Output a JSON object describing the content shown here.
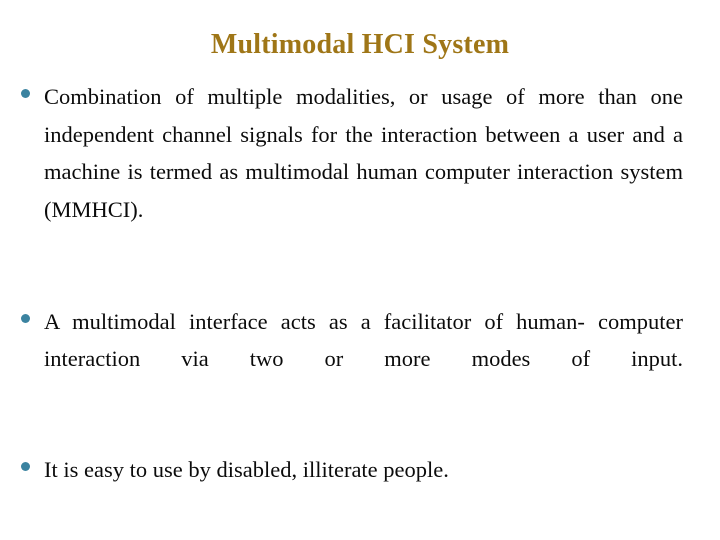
{
  "slide": {
    "title": "Multimodal HCI System",
    "title_color": "#9f7617",
    "background_color": "#ffffff",
    "body_text_color": "#0b0b0b",
    "bullet_marker_color": "#3b83a0",
    "bullets": [
      {
        "id": "bullet-combination-of-modalities",
        "marker": "disc-bullet-icon",
        "text": "Combination of multiple modalities, or usage of more than one independent channel signals for the interaction between a user and a machine is termed as multimodal human computer interaction system (MMHCI).",
        "lines": [
          "Combination of multiple modalities, or usage of",
          "more than one independent channel signals for the",
          "interaction between a user and a machine is termed as",
          "multimodal human computer interaction system",
          "(MMHCI)."
        ]
      },
      {
        "id": "bullet-multimodal-interface-facilitator",
        "marker": "disc-bullet-icon",
        "text": "A multimodal interface acts as a facilitator of human- computer interaction via two or more modes of input.",
        "lines": [
          "A multimodal interface acts as a facilitator of",
          "human- computer interaction via two or more modes of",
          "input."
        ]
      },
      {
        "id": "bullet-easy-to-use",
        "marker": "disc-bullet-icon",
        "text": "It is easy to use by disabled, illiterate people.",
        "lines": [
          "It is easy to use by disabled, illiterate people."
        ]
      }
    ]
  }
}
